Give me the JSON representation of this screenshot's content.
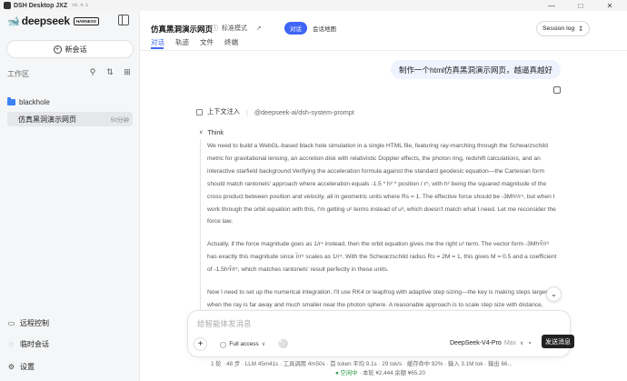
{
  "window": {
    "app_title": "DSH Desktop JXZ",
    "version": "v0.4.1",
    "min_icon": "minimize-icon",
    "max_icon": "maximize-icon",
    "close_icon": "close-icon"
  },
  "sidebar": {
    "brand": "deepseek",
    "brand_badge": "HARNESS",
    "new_chat_label": "新会话",
    "workspace_label": "工作区",
    "folder_name": "blackhole",
    "session": {
      "title": "仿真黑洞演示网页",
      "age": "50分钟"
    },
    "bottom_items": [
      {
        "label": "远程控制",
        "icon": "remote-control-icon",
        "glyph": "▭"
      },
      {
        "label": "临时会话",
        "icon": "temporary-chat-icon",
        "glyph": "◌"
      },
      {
        "label": "设置",
        "icon": "gear-icon",
        "glyph": "⚙"
      }
    ]
  },
  "header": {
    "title": "仿真黑洞演示网页",
    "mode_label": "标准模式",
    "segment": {
      "active": "对话",
      "inactive": "会话地图"
    },
    "session_log_label": "Session log",
    "tabs": [
      "对话",
      "轨迹",
      "文件",
      "终端"
    ]
  },
  "conversation": {
    "user_message": "制作一个html仿真黑洞演示网页，越逼真越好",
    "context_label": "上下文注入",
    "context_ref": "@deepseek-ai/dsh-system-prompt",
    "think_label": "Think",
    "think_paragraphs": [
      "We need to build a WebGL-based black hole simulation in a single HTML file, featuring ray-marching through the Schwarzschild metric for gravitational lensing, an accretion disk with relativistic Doppler effects, the photon ring, redshift calculations, and an interactive starfield background.Verifying the acceleration formula against the standard geodesic equation—the Cartesian form should match rantonels' approach where acceleration equals -1.5 * h² * position / r⁵, with h² being the squared magnitude of the cross product between position and velocity, all in geometric units where Rs = 1. The effective force should be -3Mh²/r⁴, but when I work through the orbit equation with this, I'm getting u² terms instead of u³, which doesn't match what I need. Let me reconsider the force law.",
      "Actually, if the force magnitude goes as 1/r⁴ instead, then the orbit equation gives me the right u² term. The vector form -3Mh²r̂/r³ has exactly this magnitude since r̂/r⁵ scales as 1/r⁴. With the Schwarzschild radius Rs = 2M = 1, this gives M = 0.5 and a coefficient of -1.5h²r̂/r⁵, which matches rantonels' result perfectly in these units.",
      "Now I need to set up the numerical integration. I'll use RK4 or leapfrog with adaptive step sizing—the key is making steps larger when the ray is far away and much smaller near the photon sphere. A reasonable approach is to scale step size with distance, something like dt proportional to r or r^1.5, clamped to reasonable bounds to avoid"
    ]
  },
  "composer": {
    "placeholder": "给智能体发消息",
    "access_label": "Full access",
    "model_label": "DeepSeek-V4-Pro",
    "model_suffix": "Max",
    "send_label": "发送消息"
  },
  "status": {
    "line1": "1 轮 · 48 步  ·  LLM 45m41s · 工具调用 4m50s  ·  首 token 平均 9.1s · 29 tok/s  ·  缓存命中 92%  ·  输入 3.1M tok · 输出 66...",
    "idle": "● 空闲中",
    "cost": "· 本轮 ¥2.444 余额 ¥65.20"
  }
}
